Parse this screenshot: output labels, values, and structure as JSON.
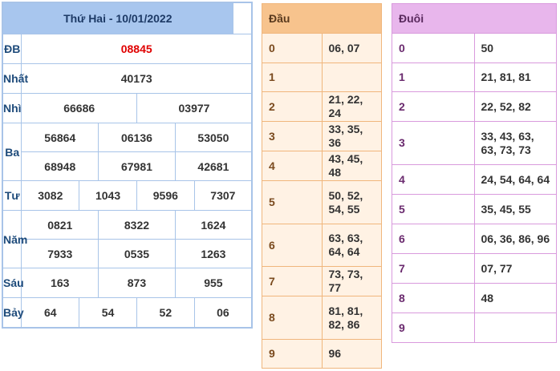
{
  "results": {
    "title": "Thứ Hai - 10/01/2022",
    "prizes": [
      {
        "label": "ĐB",
        "values": [
          "08845"
        ]
      },
      {
        "label": "Nhất",
        "values": [
          "40173"
        ]
      },
      {
        "label": "Nhì",
        "values": [
          "66686",
          "03977"
        ]
      },
      {
        "label": "Ba",
        "values": [
          "56864",
          "06136",
          "53050",
          "68948",
          "67981",
          "42681"
        ]
      },
      {
        "label": "Tư",
        "values": [
          "3082",
          "1043",
          "9596",
          "7307"
        ]
      },
      {
        "label": "Năm",
        "values": [
          "0821",
          "8322",
          "1624",
          "7933",
          "0535",
          "1263"
        ]
      },
      {
        "label": "Sáu",
        "values": [
          "163",
          "873",
          "955"
        ]
      },
      {
        "label": "Bảy",
        "values": [
          "64",
          "54",
          "52",
          "06"
        ]
      }
    ]
  },
  "head": {
    "title": "Đầu",
    "rows": [
      {
        "key": "0",
        "value": "06, 07"
      },
      {
        "key": "1",
        "value": ""
      },
      {
        "key": "2",
        "value": "21, 22, 24"
      },
      {
        "key": "3",
        "value": "33, 35, 36"
      },
      {
        "key": "4",
        "value": "43, 45, 48"
      },
      {
        "key": "5",
        "value": "50, 52, 54, 55"
      },
      {
        "key": "6",
        "value": "63, 63, 64, 64"
      },
      {
        "key": "7",
        "value": "73, 73, 77"
      },
      {
        "key": "8",
        "value": "81, 81, 82, 86"
      },
      {
        "key": "9",
        "value": "96"
      }
    ]
  },
  "tail": {
    "title": "Đuôi",
    "rows": [
      {
        "key": "0",
        "value": "50"
      },
      {
        "key": "1",
        "value": "21, 81, 81"
      },
      {
        "key": "2",
        "value": "22, 52, 82"
      },
      {
        "key": "3",
        "value": "33, 43, 63, 63, 73, 73"
      },
      {
        "key": "4",
        "value": "24, 54, 64, 64"
      },
      {
        "key": "5",
        "value": "35, 45, 55"
      },
      {
        "key": "6",
        "value": "06, 36, 86, 96"
      },
      {
        "key": "7",
        "value": "07, 77"
      },
      {
        "key": "8",
        "value": "48"
      },
      {
        "key": "9",
        "value": ""
      }
    ]
  }
}
